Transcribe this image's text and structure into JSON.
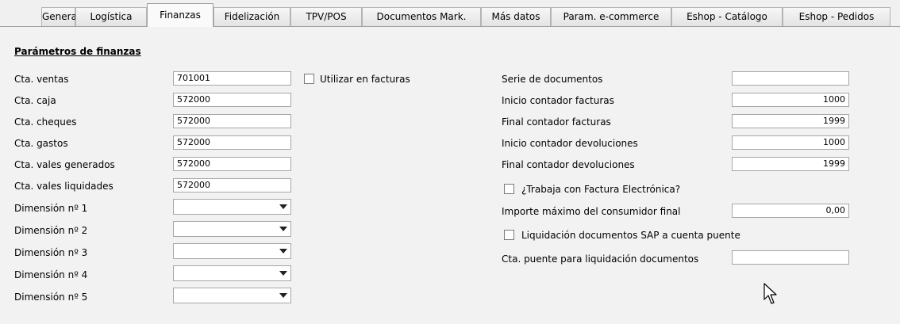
{
  "tabs": [
    {
      "label": "General"
    },
    {
      "label": "Logística"
    },
    {
      "label": "Finanzas"
    },
    {
      "label": "Fidelización"
    },
    {
      "label": "TPV/POS"
    },
    {
      "label": "Documentos Mark."
    },
    {
      "label": "Más datos"
    },
    {
      "label": "Param. e-commerce"
    },
    {
      "label": "Eshop - Catálogo"
    },
    {
      "label": "Eshop - Pedidos"
    }
  ],
  "active_tab": "Finanzas",
  "section_title": "Parámetros de finanzas",
  "left": {
    "cta_ventas": {
      "label": "Cta. ventas",
      "value": "701001"
    },
    "cta_caja": {
      "label": "Cta. caja",
      "value": "572000"
    },
    "cta_cheques": {
      "label": "Cta. cheques",
      "value": "572000"
    },
    "cta_gastos": {
      "label": "Cta. gastos",
      "value": "572000"
    },
    "cta_vales_generados": {
      "label": "Cta. vales generados",
      "value": "572000"
    },
    "cta_vales_liquidados": {
      "label": "Cta. vales liquidades",
      "value": "572000"
    },
    "dim1": {
      "label": "Dimensión nº 1",
      "value": ""
    },
    "dim2": {
      "label": "Dimensión nº 2",
      "value": ""
    },
    "dim3": {
      "label": "Dimensión nº 3",
      "value": ""
    },
    "dim4": {
      "label": "Dimensión nº 4",
      "value": ""
    },
    "dim5": {
      "label": "Dimensión nº 5",
      "value": ""
    }
  },
  "utilizar_facturas": {
    "label": "Utilizar en facturas",
    "checked": false
  },
  "right": {
    "serie": {
      "label": "Serie de documentos",
      "value": ""
    },
    "inicio_facturas": {
      "label": "Inicio contador facturas",
      "value": "1000"
    },
    "final_facturas": {
      "label": "Final contador facturas",
      "value": "1999"
    },
    "inicio_devoluciones": {
      "label": "Inicio contador devoluciones",
      "value": "1000"
    },
    "final_devoluciones": {
      "label": "Final contador devoluciones",
      "value": "1999"
    },
    "factura_electronica": {
      "label": "¿Trabaja con Factura Electrónica?",
      "checked": false
    },
    "importe_maximo": {
      "label": "Importe máximo del consumidor final",
      "value": "0,00"
    },
    "liquidacion_sap": {
      "label": "Liquidación documentos SAP a cuenta puente",
      "checked": false
    },
    "cta_puente": {
      "label": "Cta. puente para liquidación documentos",
      "value": ""
    }
  },
  "icons": {
    "dropdown": "chevron-down-icon",
    "pointer": "mouse-pointer-icon"
  }
}
